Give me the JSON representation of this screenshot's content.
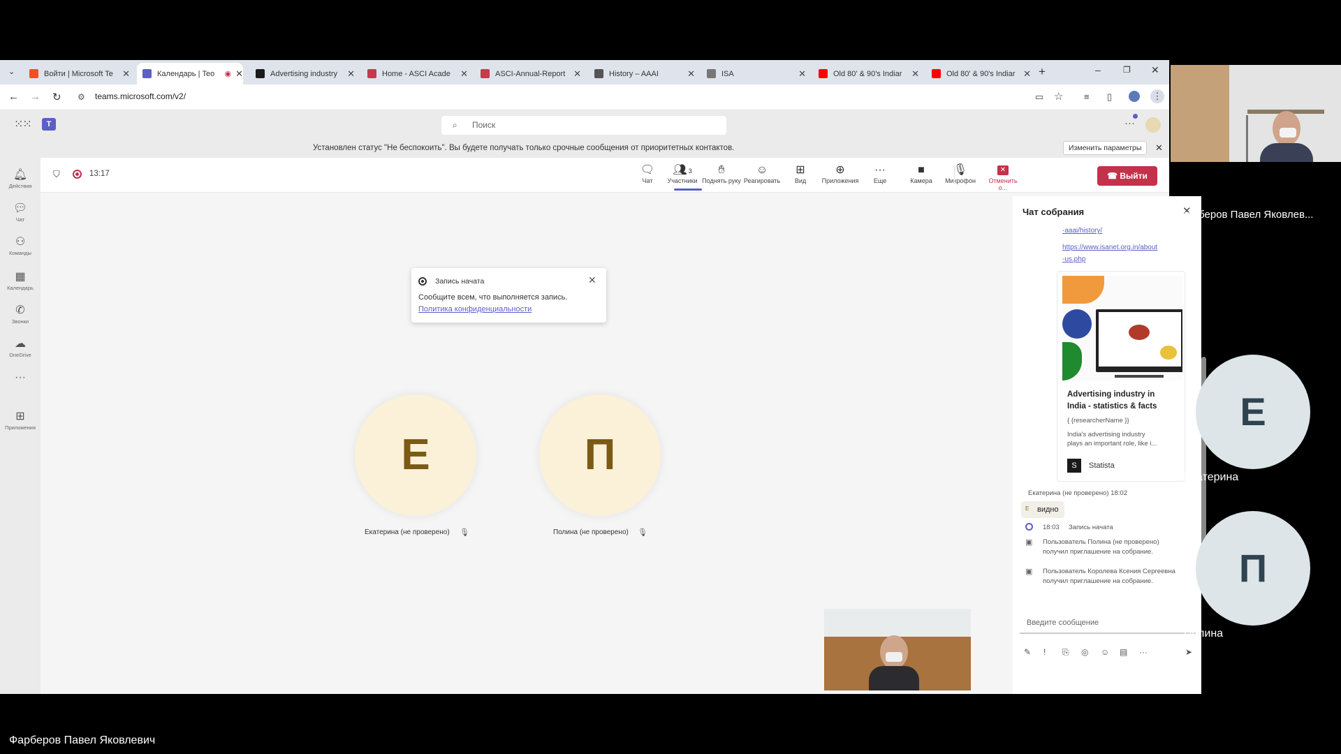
{
  "tabs": [
    {
      "label": "Войти | Microsoft Te",
      "color": "#f25022"
    },
    {
      "label": "Календарь | Teo",
      "color": "#5b5fc7"
    },
    {
      "label": "Advertising industry",
      "color": "#1a1a1a"
    },
    {
      "label": "Home - ASCI Acade",
      "color": "#c53b4b"
    },
    {
      "label": "ASCI-Annual-Report",
      "color": "#c53b4b"
    },
    {
      "label": "History – AAAI",
      "color": "#555555"
    },
    {
      "label": "ISA",
      "color": "#777777"
    },
    {
      "label": "Old 80' & 90's Indiar",
      "color": "#ff0000"
    },
    {
      "label": "Old 80' & 90's Indiar",
      "color": "#ff0000"
    }
  ],
  "address": {
    "url": "teams.microsoft.com/v2/"
  },
  "teams": {
    "search_placeholder": "Поиск",
    "notice": "Установлен статус \"Не беспокоить\". Вы будете получать только срочные сообщения от приоритетных контактов.",
    "notice_button": "Изменить параметры"
  },
  "rail": [
    "Действия",
    "Чат",
    "Команды",
    "Календарь",
    "Звонки",
    "OneDrive",
    "Приложения"
  ],
  "meeting": {
    "timer": "13:17",
    "tools": [
      {
        "label": "Чат",
        "icon": "chat-icon"
      },
      {
        "label": "Участники",
        "icon": "people-icon",
        "badge": "3"
      },
      {
        "label": "Поднять руку",
        "icon": "hand-icon"
      },
      {
        "label": "Реагировать",
        "icon": "smile-icon"
      },
      {
        "label": "Вид",
        "icon": "grid-icon"
      },
      {
        "label": "Приложения",
        "icon": "apps-icon"
      },
      {
        "label": "Еще",
        "icon": "more-icon"
      },
      {
        "label": "Камера",
        "icon": "camera-icon"
      },
      {
        "label": "Микрофон",
        "icon": "mic-icon"
      },
      {
        "label": "Отменить о...",
        "icon": "share-stop-icon"
      }
    ],
    "leave": "Выйти",
    "toast": {
      "title": "Запись начата",
      "body": "Сообщите всем, что выполняется запись.",
      "link": "Политика конфиденциальности"
    },
    "participants": [
      {
        "initial": "Е",
        "label": "Екатерина (не проверено)"
      },
      {
        "initial": "П",
        "label": "Полина (не проверено)"
      }
    ]
  },
  "chat": {
    "title": "Чат собрания",
    "link1": "-aaai/history/",
    "link2a": "https://www.isanet.org.in/about",
    "link2b": "-us.php",
    "card_title_1": "Advertising industry in",
    "card_title_2": "India - statistics & facts",
    "card_author": "{ {researcherName }}",
    "card_desc_1": "India's advertising industry",
    "card_desc_2": "plays an important role, like i...",
    "card_source": "Statista",
    "msg_meta": "Екатерина (не проверено)  18:02",
    "msg_initial": "Е",
    "msg_text": "видно",
    "event_time": "18:03",
    "event_text": "Запись начата",
    "sys1_a": "Пользователь Полина (не проверено)",
    "sys1_b": "получил приглашение на собрание.",
    "sys2_a": "Пользователь Королева Ксения Сергеевна",
    "sys2_b": "получил приглашение на собрание.",
    "input_placeholder": "Введите сообщение"
  },
  "gallery": {
    "presenter": "Фарберов Павел Яковлев...",
    "p1_initial": "Е",
    "p1_name": "Екатерина",
    "p2_initial": "П",
    "p2_name": "Полина"
  },
  "bottom_name": "Фарберов Павел Яковлевич"
}
